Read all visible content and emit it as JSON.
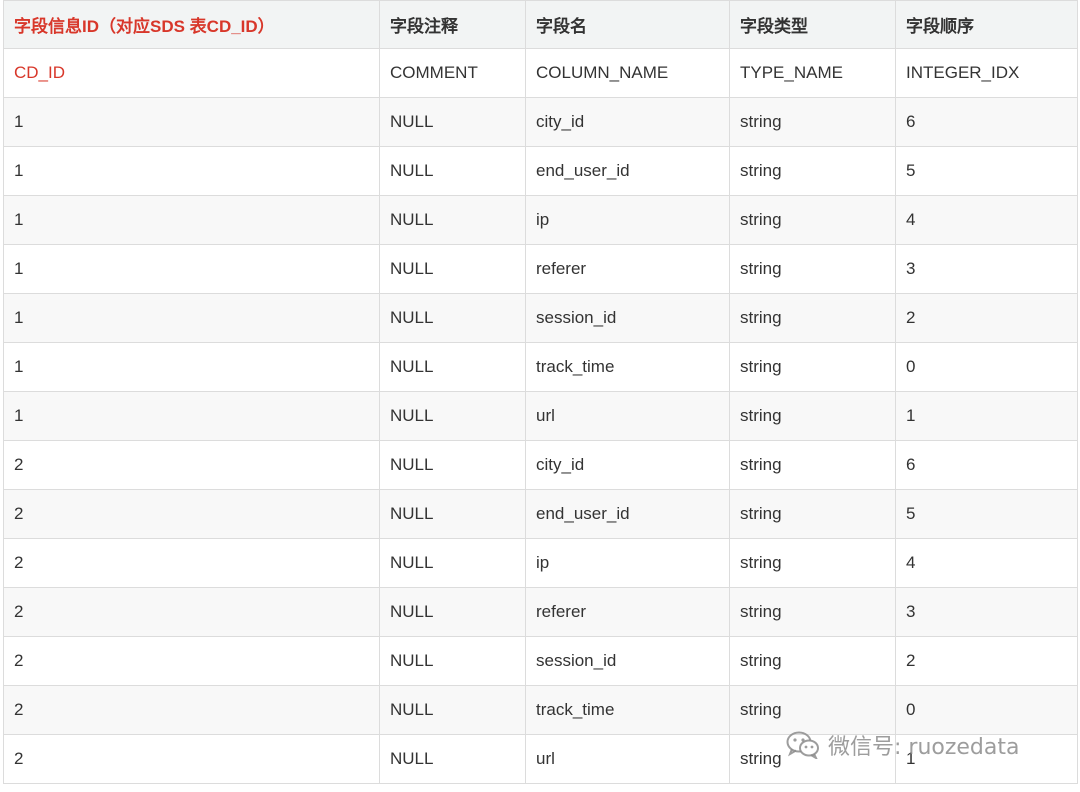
{
  "table": {
    "headers": [
      {
        "label": "字段信息ID（对应SDS 表CD_ID）",
        "highlight": true
      },
      {
        "label": "字段注释",
        "highlight": false
      },
      {
        "label": "字段名",
        "highlight": false
      },
      {
        "label": "字段类型",
        "highlight": false
      },
      {
        "label": "字段顺序",
        "highlight": false
      }
    ],
    "subheader": [
      "CD_ID",
      "COMMENT",
      "COLUMN_NAME",
      "TYPE_NAME",
      "INTEGER_IDX"
    ],
    "rows": [
      [
        "1",
        "NULL",
        "city_id",
        "string",
        "6"
      ],
      [
        "1",
        "NULL",
        "end_user_id",
        "string",
        "5"
      ],
      [
        "1",
        "NULL",
        "ip",
        "string",
        "4"
      ],
      [
        "1",
        "NULL",
        "referer",
        "string",
        "3"
      ],
      [
        "1",
        "NULL",
        "session_id",
        "string",
        "2"
      ],
      [
        "1",
        "NULL",
        "track_time",
        "string",
        "0"
      ],
      [
        "1",
        "NULL",
        "url",
        "string",
        "1"
      ],
      [
        "2",
        "NULL",
        "city_id",
        "string",
        "6"
      ],
      [
        "2",
        "NULL",
        "end_user_id",
        "string",
        "5"
      ],
      [
        "2",
        "NULL",
        "ip",
        "string",
        "4"
      ],
      [
        "2",
        "NULL",
        "referer",
        "string",
        "3"
      ],
      [
        "2",
        "NULL",
        "session_id",
        "string",
        "2"
      ],
      [
        "2",
        "NULL",
        "track_time",
        "string",
        "0"
      ],
      [
        "2",
        "NULL",
        "url",
        "string",
        "1"
      ]
    ]
  },
  "watermark": {
    "text": "微信号: ruozedata",
    "icon": "wechat-icon"
  },
  "colors": {
    "highlight": "#d8372a",
    "header_bg": "#f2f4f4",
    "border": "#dcdcdc",
    "text": "#333333"
  }
}
